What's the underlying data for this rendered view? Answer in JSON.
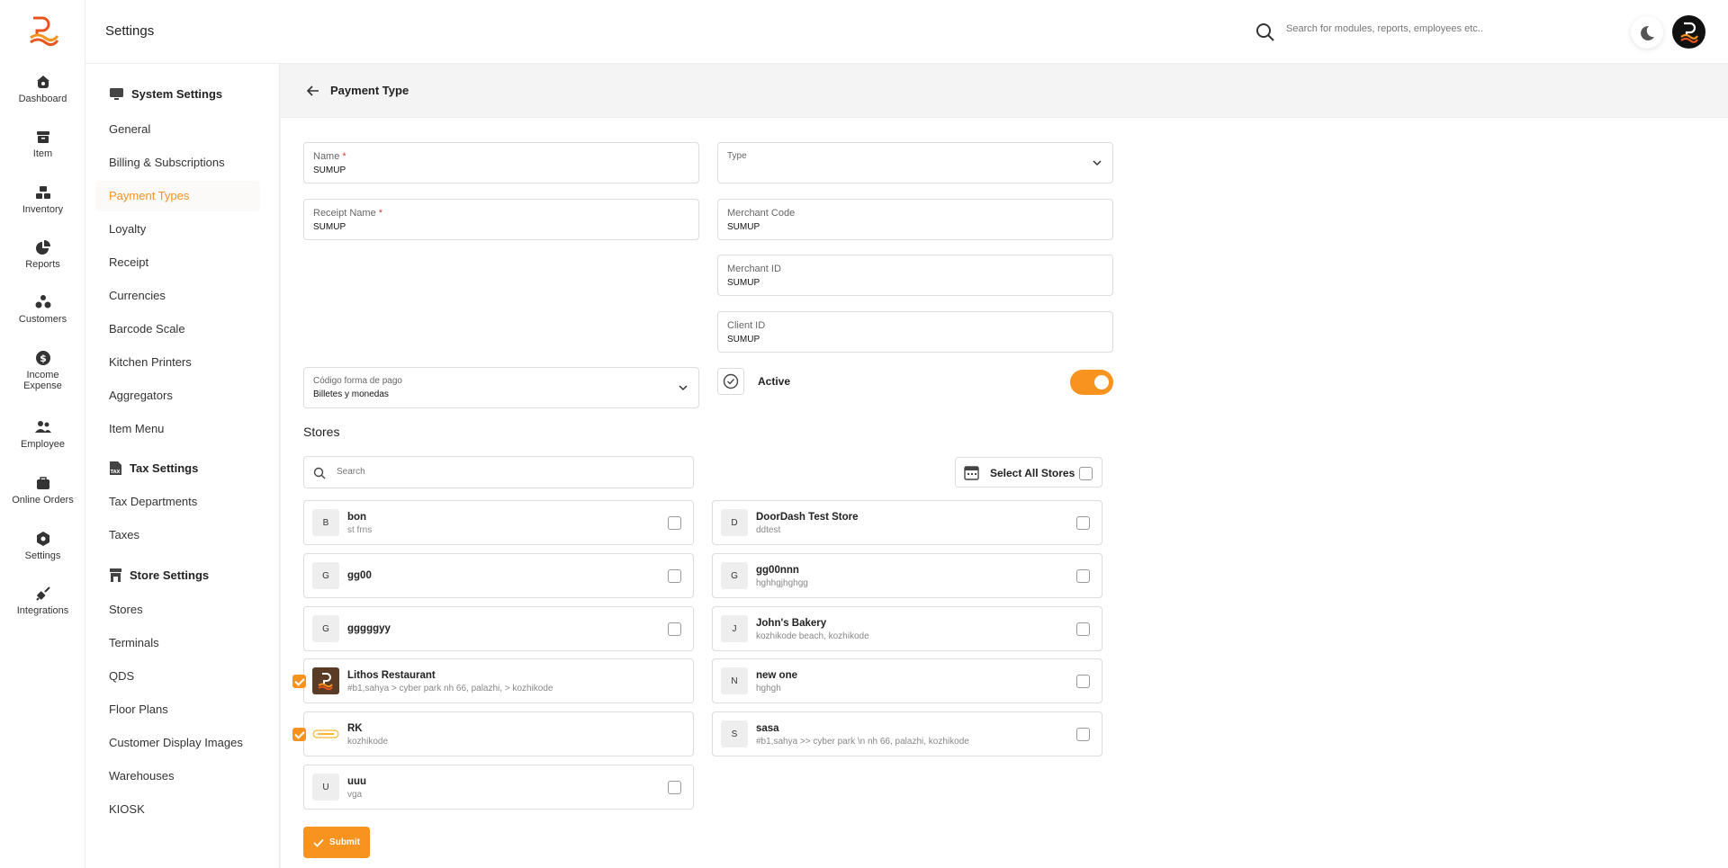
{
  "app": {
    "title": "Settings",
    "search_placeholder": "Search for modules, reports, employees etc.."
  },
  "colors": {
    "accent": "#f7931e",
    "active_text": "#f7931e"
  },
  "nav": {
    "items": [
      {
        "label": "Dashboard",
        "icon": "home-icon"
      },
      {
        "label": "Item",
        "icon": "box-icon"
      },
      {
        "label": "Inventory",
        "icon": "inventory-icon"
      },
      {
        "label": "Reports",
        "icon": "pie-chart-icon"
      },
      {
        "label": "Customers",
        "icon": "customers-icon"
      },
      {
        "label": "Income",
        "label2": "Expense",
        "icon": "dollar-icon"
      },
      {
        "label": "Employee",
        "icon": "employee-icon"
      },
      {
        "label": "Online Orders",
        "icon": "bag-icon"
      },
      {
        "label": "Settings",
        "icon": "gear-icon"
      },
      {
        "label": "Integrations",
        "icon": "plug-icon"
      }
    ]
  },
  "settings_menu": {
    "system_title": "System Settings",
    "system_items": [
      "General",
      "Billing & Subscriptions",
      "Payment Types",
      "Loyalty",
      "Receipt",
      "Currencies",
      "Barcode Scale",
      "Kitchen Printers",
      "Aggregators",
      "Item Menu"
    ],
    "tax_title": "Tax Settings",
    "tax_items": [
      "Tax Departments",
      "Taxes"
    ],
    "store_title": "Store Settings",
    "store_items": [
      "Stores",
      "Terminals",
      "QDS",
      "Floor Plans",
      "Customer Display Images",
      "Warehouses",
      "KIOSK"
    ],
    "active_item": "Payment Types"
  },
  "page": {
    "title": "Payment Type"
  },
  "form": {
    "name": {
      "label": "Name",
      "required": "*",
      "value": "SUMUP"
    },
    "type": {
      "label": "Type",
      "value": ""
    },
    "receipt_name": {
      "label": "Receipt Name",
      "required": "*",
      "value": "SUMUP"
    },
    "merchant_code": {
      "label": "Merchant Code",
      "value": "SUMUP"
    },
    "merchant_id": {
      "label": "Merchant ID",
      "value": "SUMUP"
    },
    "client_id": {
      "label": "Client ID",
      "value": "SUMUP"
    },
    "codigo": {
      "label": "Código forma de pago",
      "value": "Billetes y monedas"
    },
    "active": {
      "label": "Active",
      "on": true
    }
  },
  "stores": {
    "title": "Stores",
    "search_placeholder": "Search",
    "select_all_label": "Select All Stores",
    "list": [
      {
        "initial": "B",
        "name": "bon",
        "address": "st frns",
        "checked": false
      },
      {
        "initial": "D",
        "name": "DoorDash Test Store",
        "address": "ddtest",
        "checked": false
      },
      {
        "initial": "G",
        "name": "gg00",
        "address": "",
        "checked": false
      },
      {
        "initial": "G",
        "name": "gg00nnn",
        "address": "hghhgjhghgg",
        "checked": false
      },
      {
        "initial": "G",
        "name": "gggggyy",
        "address": "",
        "checked": false
      },
      {
        "initial": "J",
        "name": "John's Bakery",
        "address": "kozhikode beach, kozhikode",
        "checked": false
      },
      {
        "initial": "",
        "logo": "restaurant-logo-icon",
        "name": "Lithos Restaurant",
        "address": "#b1,sahya > cyber park nh 66, palazhi, > kozhikode",
        "checked": true
      },
      {
        "initial": "N",
        "name": "new one",
        "address": "hghgh",
        "checked": false
      },
      {
        "initial": "",
        "logo": "rk-logo-icon",
        "name": "RK",
        "address": "kozhikode",
        "checked": true
      },
      {
        "initial": "S",
        "name": "sasa",
        "address": "#b1,sahya >> cyber park \\n nh 66, palazhi, kozhikode",
        "checked": false
      },
      {
        "initial": "U",
        "name": "uuu",
        "address": "vga",
        "checked": false
      }
    ]
  },
  "submit_label": "Submit"
}
